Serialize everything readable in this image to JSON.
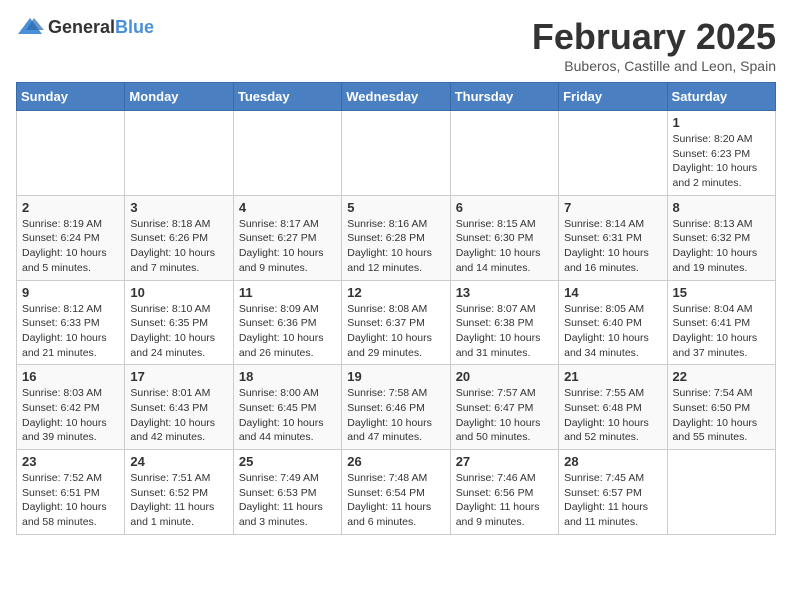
{
  "logo": {
    "general": "General",
    "blue": "Blue"
  },
  "title": "February 2025",
  "subtitle": "Buberos, Castille and Leon, Spain",
  "weekdays": [
    "Sunday",
    "Monday",
    "Tuesday",
    "Wednesday",
    "Thursday",
    "Friday",
    "Saturday"
  ],
  "weeks": [
    [
      {
        "day": "",
        "info": ""
      },
      {
        "day": "",
        "info": ""
      },
      {
        "day": "",
        "info": ""
      },
      {
        "day": "",
        "info": ""
      },
      {
        "day": "",
        "info": ""
      },
      {
        "day": "",
        "info": ""
      },
      {
        "day": "1",
        "info": "Sunrise: 8:20 AM\nSunset: 6:23 PM\nDaylight: 10 hours and 2 minutes."
      }
    ],
    [
      {
        "day": "2",
        "info": "Sunrise: 8:19 AM\nSunset: 6:24 PM\nDaylight: 10 hours and 5 minutes."
      },
      {
        "day": "3",
        "info": "Sunrise: 8:18 AM\nSunset: 6:26 PM\nDaylight: 10 hours and 7 minutes."
      },
      {
        "day": "4",
        "info": "Sunrise: 8:17 AM\nSunset: 6:27 PM\nDaylight: 10 hours and 9 minutes."
      },
      {
        "day": "5",
        "info": "Sunrise: 8:16 AM\nSunset: 6:28 PM\nDaylight: 10 hours and 12 minutes."
      },
      {
        "day": "6",
        "info": "Sunrise: 8:15 AM\nSunset: 6:30 PM\nDaylight: 10 hours and 14 minutes."
      },
      {
        "day": "7",
        "info": "Sunrise: 8:14 AM\nSunset: 6:31 PM\nDaylight: 10 hours and 16 minutes."
      },
      {
        "day": "8",
        "info": "Sunrise: 8:13 AM\nSunset: 6:32 PM\nDaylight: 10 hours and 19 minutes."
      }
    ],
    [
      {
        "day": "9",
        "info": "Sunrise: 8:12 AM\nSunset: 6:33 PM\nDaylight: 10 hours and 21 minutes."
      },
      {
        "day": "10",
        "info": "Sunrise: 8:10 AM\nSunset: 6:35 PM\nDaylight: 10 hours and 24 minutes."
      },
      {
        "day": "11",
        "info": "Sunrise: 8:09 AM\nSunset: 6:36 PM\nDaylight: 10 hours and 26 minutes."
      },
      {
        "day": "12",
        "info": "Sunrise: 8:08 AM\nSunset: 6:37 PM\nDaylight: 10 hours and 29 minutes."
      },
      {
        "day": "13",
        "info": "Sunrise: 8:07 AM\nSunset: 6:38 PM\nDaylight: 10 hours and 31 minutes."
      },
      {
        "day": "14",
        "info": "Sunrise: 8:05 AM\nSunset: 6:40 PM\nDaylight: 10 hours and 34 minutes."
      },
      {
        "day": "15",
        "info": "Sunrise: 8:04 AM\nSunset: 6:41 PM\nDaylight: 10 hours and 37 minutes."
      }
    ],
    [
      {
        "day": "16",
        "info": "Sunrise: 8:03 AM\nSunset: 6:42 PM\nDaylight: 10 hours and 39 minutes."
      },
      {
        "day": "17",
        "info": "Sunrise: 8:01 AM\nSunset: 6:43 PM\nDaylight: 10 hours and 42 minutes."
      },
      {
        "day": "18",
        "info": "Sunrise: 8:00 AM\nSunset: 6:45 PM\nDaylight: 10 hours and 44 minutes."
      },
      {
        "day": "19",
        "info": "Sunrise: 7:58 AM\nSunset: 6:46 PM\nDaylight: 10 hours and 47 minutes."
      },
      {
        "day": "20",
        "info": "Sunrise: 7:57 AM\nSunset: 6:47 PM\nDaylight: 10 hours and 50 minutes."
      },
      {
        "day": "21",
        "info": "Sunrise: 7:55 AM\nSunset: 6:48 PM\nDaylight: 10 hours and 52 minutes."
      },
      {
        "day": "22",
        "info": "Sunrise: 7:54 AM\nSunset: 6:50 PM\nDaylight: 10 hours and 55 minutes."
      }
    ],
    [
      {
        "day": "23",
        "info": "Sunrise: 7:52 AM\nSunset: 6:51 PM\nDaylight: 10 hours and 58 minutes."
      },
      {
        "day": "24",
        "info": "Sunrise: 7:51 AM\nSunset: 6:52 PM\nDaylight: 11 hours and 1 minute."
      },
      {
        "day": "25",
        "info": "Sunrise: 7:49 AM\nSunset: 6:53 PM\nDaylight: 11 hours and 3 minutes."
      },
      {
        "day": "26",
        "info": "Sunrise: 7:48 AM\nSunset: 6:54 PM\nDaylight: 11 hours and 6 minutes."
      },
      {
        "day": "27",
        "info": "Sunrise: 7:46 AM\nSunset: 6:56 PM\nDaylight: 11 hours and 9 minutes."
      },
      {
        "day": "28",
        "info": "Sunrise: 7:45 AM\nSunset: 6:57 PM\nDaylight: 11 hours and 11 minutes."
      },
      {
        "day": "",
        "info": ""
      }
    ]
  ]
}
